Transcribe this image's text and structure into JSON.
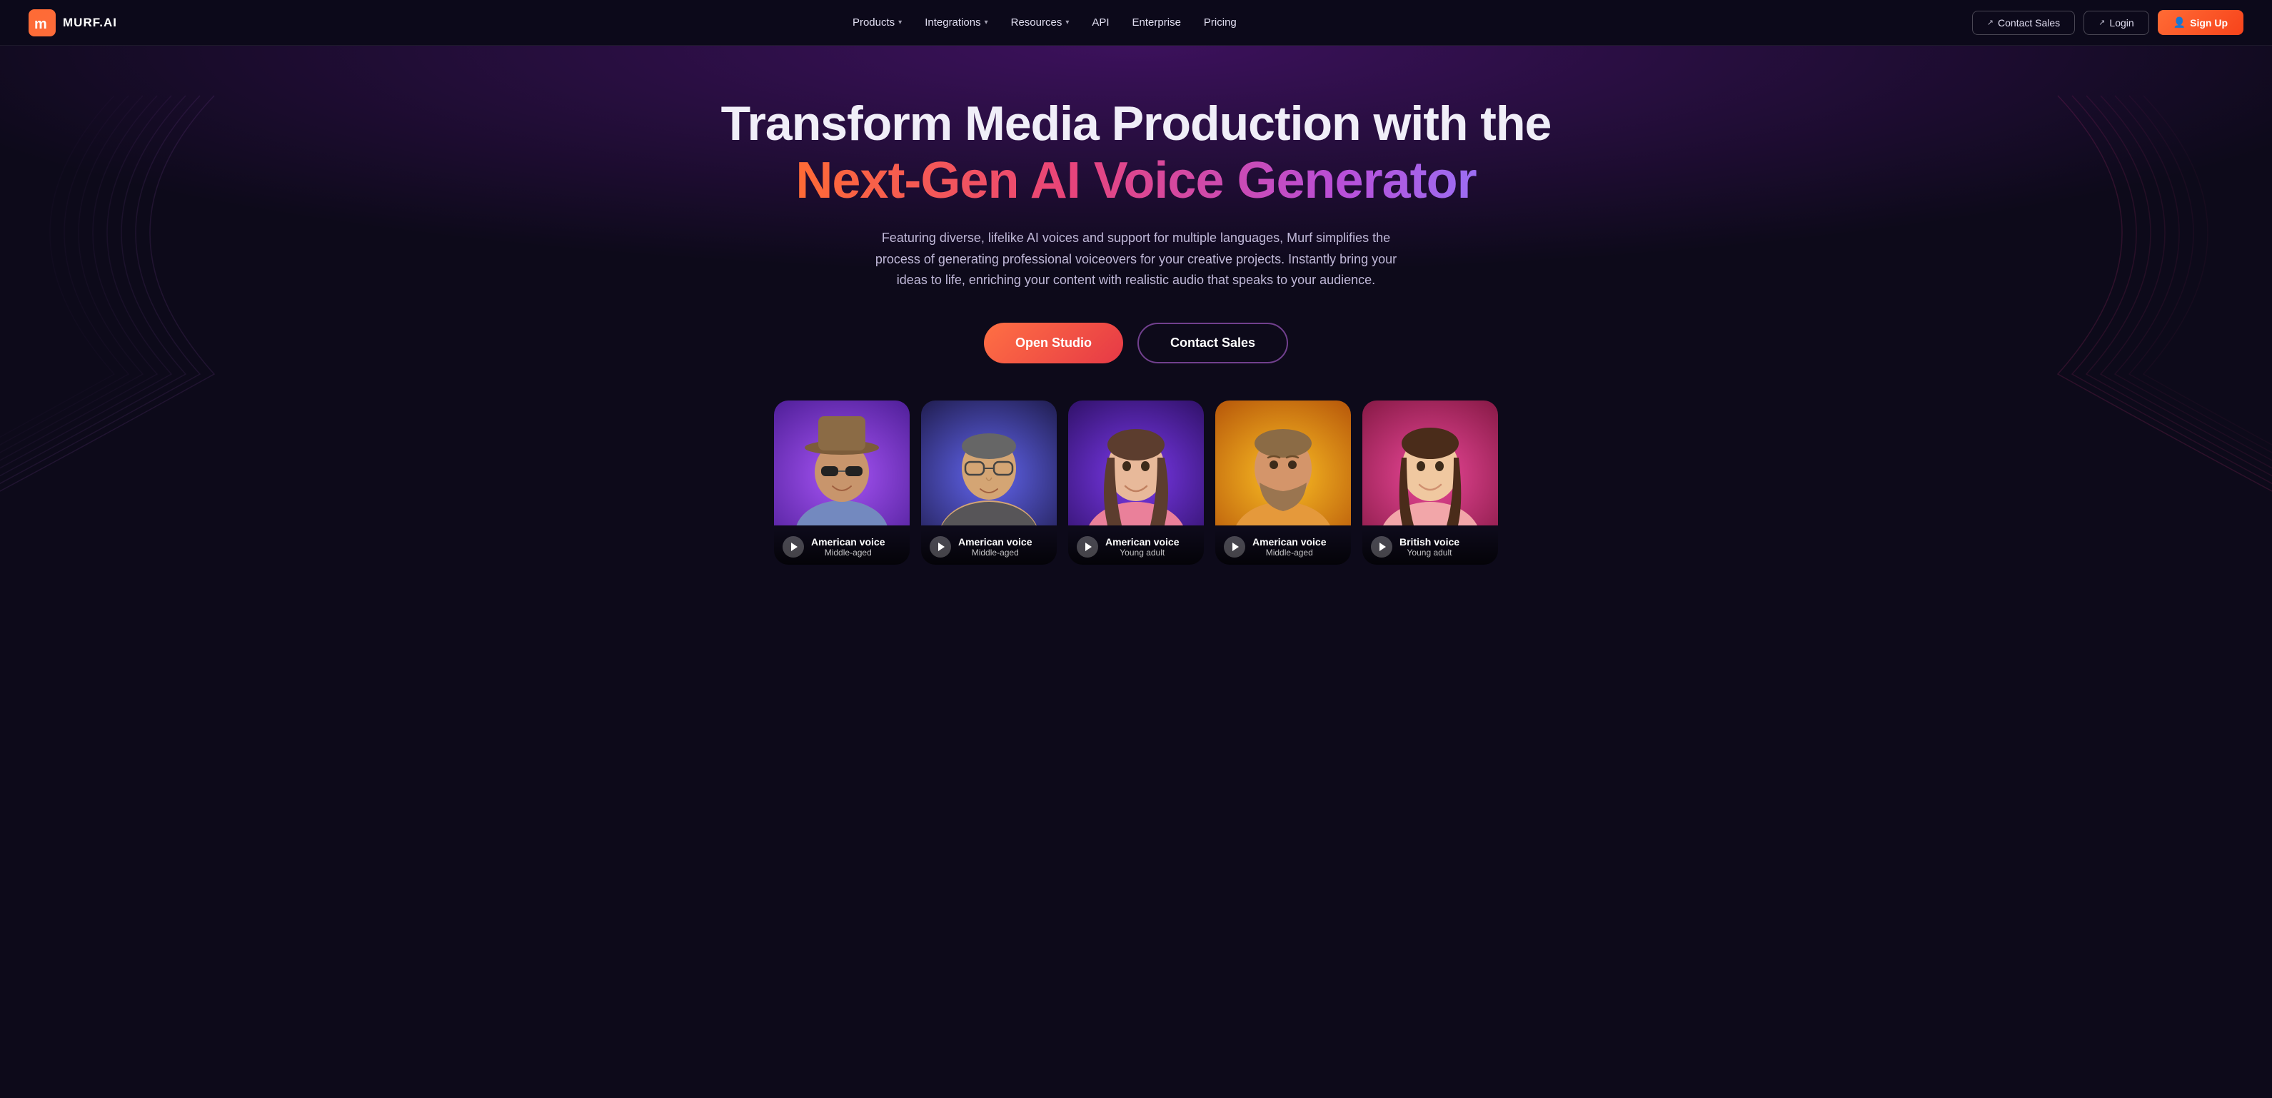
{
  "brand": {
    "name": "MURF.AI",
    "logoText": "M"
  },
  "nav": {
    "links": [
      {
        "label": "Products",
        "hasDropdown": true
      },
      {
        "label": "Integrations",
        "hasDropdown": true
      },
      {
        "label": "Resources",
        "hasDropdown": true
      },
      {
        "label": "API",
        "hasDropdown": false
      },
      {
        "label": "Enterprise",
        "hasDropdown": false
      },
      {
        "label": "Pricing",
        "hasDropdown": false
      }
    ],
    "contact_sales_label": "Contact Sales",
    "login_label": "Login",
    "signup_label": "Sign Up"
  },
  "hero": {
    "title_white": "Transform Media Production with the",
    "title_gradient": "Next-Gen AI Voice Generator",
    "subtitle": "Featuring diverse, lifelike AI voices and support for multiple languages, Murf simplifies the process of generating professional voiceovers for your creative projects. Instantly bring your ideas to life, enriching your content with realistic audio that speaks to your audience.",
    "cta_primary": "Open Studio",
    "cta_secondary": "Contact Sales"
  },
  "voice_cards": [
    {
      "id": 1,
      "voice_type": "American voice",
      "age": "Middle-aged",
      "bg_class": "card-bg-purple",
      "skin_color": "#c8956c",
      "hair_color": "#3d2b1f",
      "accessory": "hat+sunglasses"
    },
    {
      "id": 2,
      "voice_type": "American voice",
      "age": "Middle-aged",
      "bg_class": "card-bg-indigo",
      "skin_color": "#d4a574",
      "hair_color": "#555",
      "accessory": "glasses"
    },
    {
      "id": 3,
      "voice_type": "American voice",
      "age": "Young adult",
      "bg_class": "card-bg-violet",
      "skin_color": "#e8b99a",
      "hair_color": "#5c3d2e",
      "accessory": "none"
    },
    {
      "id": 4,
      "voice_type": "American voice",
      "age": "Middle-aged",
      "bg_class": "card-bg-amber",
      "skin_color": "#d4956a",
      "hair_color": "#8b6b45",
      "accessory": "beard"
    },
    {
      "id": 5,
      "voice_type": "British voice",
      "age": "Young adult",
      "bg_class": "card-bg-pink",
      "skin_color": "#f0c8a0",
      "hair_color": "#4a2c1a",
      "accessory": "none"
    }
  ]
}
